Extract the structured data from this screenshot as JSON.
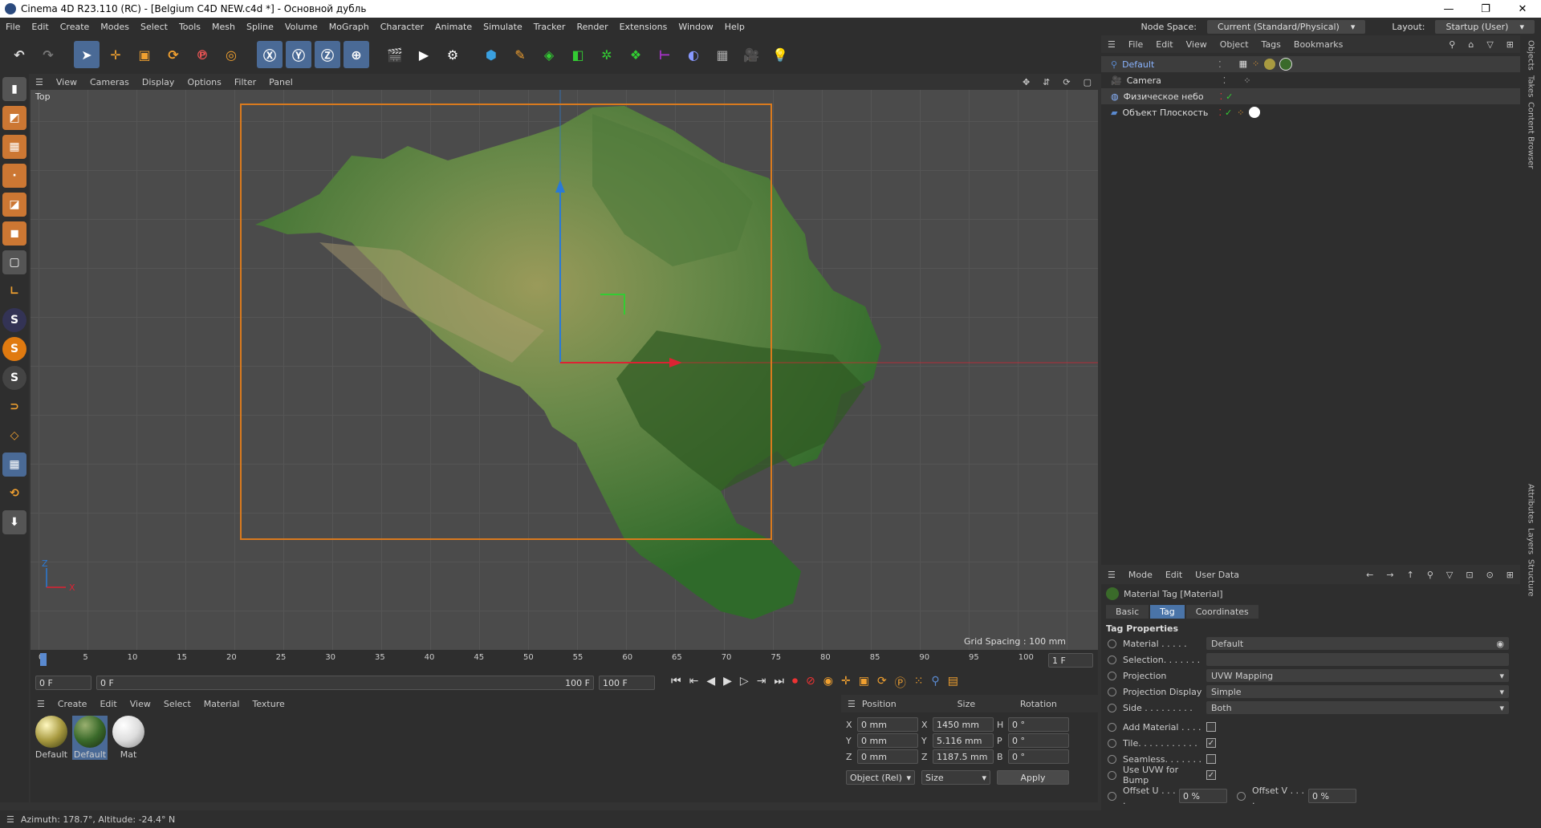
{
  "window": {
    "title": "Cinema 4D R23.110 (RC) - [Belgium C4D NEW.c4d *] - Основной дубль",
    "min": "—",
    "max": "❐",
    "close": "✕"
  },
  "menu": [
    "File",
    "Edit",
    "Create",
    "Modes",
    "Select",
    "Tools",
    "Mesh",
    "Spline",
    "Volume",
    "MoGraph",
    "Character",
    "Animate",
    "Simulate",
    "Tracker",
    "Render",
    "Extensions",
    "Window",
    "Help"
  ],
  "nodespace": {
    "label": "Node Space:",
    "value": "Current (Standard/Physical)"
  },
  "layout": {
    "label": "Layout:",
    "value": "Startup (User)"
  },
  "viewport": {
    "menu": [
      "View",
      "Cameras",
      "Display",
      "Options",
      "Filter",
      "Panel"
    ],
    "label": "Top",
    "grid_spacing": "Grid Spacing : 100 mm",
    "axis_x": "X",
    "axis_z": "Z"
  },
  "timeline": {
    "ticks": [
      "0",
      "5",
      "10",
      "15",
      "20",
      "25",
      "30",
      "35",
      "40",
      "45",
      "50",
      "55",
      "60",
      "65",
      "70",
      "75",
      "80",
      "85",
      "90",
      "95",
      "100"
    ],
    "frame": "1 F"
  },
  "transport": {
    "start": "0 F",
    "current": "0 F",
    "end_inner": "100 F",
    "end": "100 F"
  },
  "materials": {
    "menu": [
      "Create",
      "Edit",
      "View",
      "Select",
      "Material",
      "Texture"
    ],
    "items": [
      {
        "name": "Default"
      },
      {
        "name": "Default"
      },
      {
        "name": "Mat"
      }
    ]
  },
  "coords": {
    "headers": [
      "Position",
      "Size",
      "Rotation"
    ],
    "rows": [
      {
        "a": "X",
        "pos": "0 mm",
        "s": "X",
        "size": "1450 mm",
        "r": "H",
        "rot": "0 °"
      },
      {
        "a": "Y",
        "pos": "0 mm",
        "s": "Y",
        "size": "5.116 mm",
        "r": "P",
        "rot": "0 °"
      },
      {
        "a": "Z",
        "pos": "0 mm",
        "s": "Z",
        "size": "1187.5 mm",
        "r": "B",
        "rot": "0 °"
      }
    ],
    "mode": "Object (Rel)",
    "sizemode": "Size",
    "apply": "Apply"
  },
  "objects": {
    "menu": [
      "File",
      "Edit",
      "View",
      "Object",
      "Tags",
      "Bookmarks"
    ],
    "items": [
      {
        "name": "Default"
      },
      {
        "name": "Camera"
      },
      {
        "name": "Физическое небо"
      },
      {
        "name": "Объект Плоскость"
      }
    ]
  },
  "attributes": {
    "menu": [
      "Mode",
      "Edit",
      "User Data"
    ],
    "title": "Material Tag [Material]",
    "tabs": [
      "Basic",
      "Tag",
      "Coordinates"
    ],
    "section": "Tag Properties",
    "rows": [
      {
        "label": "Material . . . . .",
        "value": "Default"
      },
      {
        "label": "Selection. . . . . . .",
        "value": ""
      },
      {
        "label": "Projection",
        "value": "UVW Mapping"
      },
      {
        "label": "Projection Display",
        "value": "Simple"
      },
      {
        "label": "Side . . . . . . . . .",
        "value": "Both"
      }
    ],
    "checks": [
      {
        "label": "Add Material . . . .",
        "checked": ""
      },
      {
        "label": "Tile. . . . . . . . . . .",
        "checked": "✓"
      },
      {
        "label": "Seamless. . . . . . .",
        "checked": ""
      },
      {
        "label": "Use UVW for Bump",
        "checked": "✓"
      }
    ],
    "offset_u": {
      "label": "Offset U . . . .",
      "value": "0 %"
    },
    "offset_v": {
      "label": "Offset V . . . .",
      "value": "0 %"
    }
  },
  "sidetabs": [
    "Objects",
    "Takes",
    "Content Browser",
    "Attributes",
    "Layers",
    "Structure"
  ],
  "status": "Azimuth: 178.7°, Altitude: -24.4°  N"
}
